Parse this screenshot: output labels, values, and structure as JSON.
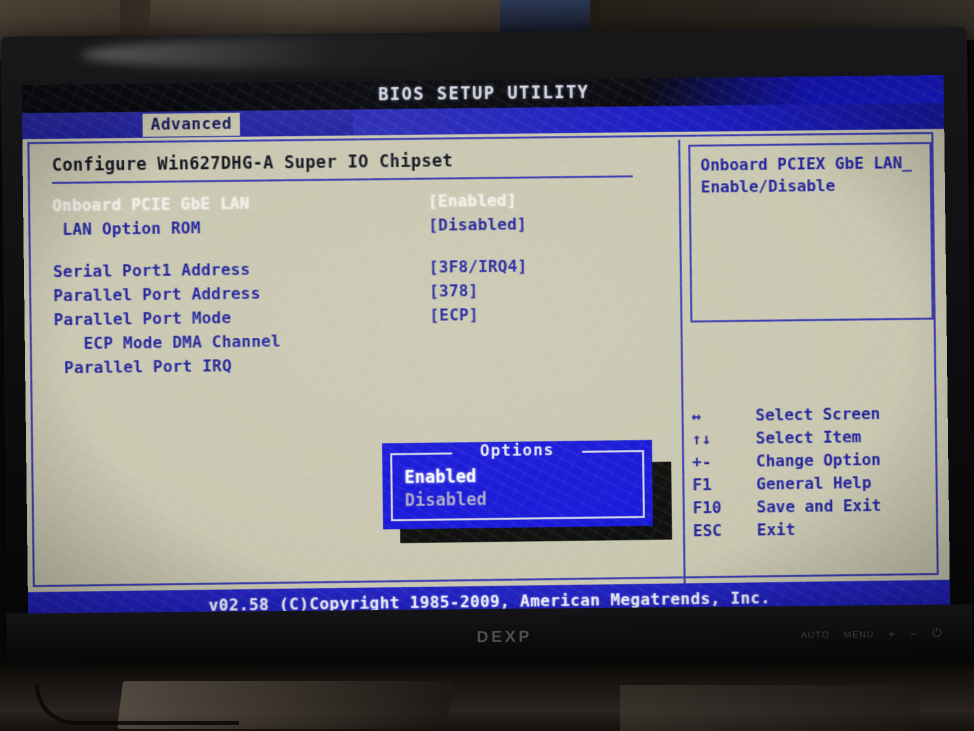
{
  "window": {
    "title": "BIOS SETUP UTILITY"
  },
  "menubar": {
    "active_tab": "Advanced"
  },
  "main": {
    "section_header": "Configure Win627DHG-A Super IO Chipset",
    "rows": [
      {
        "label": "Onboard PCIE GbE LAN",
        "value": "[Enabled]",
        "selected": true
      },
      {
        "label": " LAN Option ROM",
        "value": "[Disabled]",
        "selected": false
      },
      {
        "label": "",
        "value": "",
        "selected": false
      },
      {
        "label": "Serial Port1 Address",
        "value": "[3F8/IRQ4]",
        "selected": false
      },
      {
        "label": "Parallel Port Address",
        "value": "[378]",
        "selected": false
      },
      {
        "label": "Parallel Port Mode",
        "value": "[ECP]",
        "selected": false
      },
      {
        "label": "   ECP Mode DMA Channel",
        "value": "",
        "selected": false
      },
      {
        "label": " Parallel Port IRQ",
        "value": "",
        "selected": false
      }
    ]
  },
  "options_popup": {
    "title": "Options",
    "items": [
      {
        "label": "Enabled",
        "selected": true
      },
      {
        "label": "Disabled",
        "selected": false
      }
    ]
  },
  "help": {
    "text": "Onboard PCIEX GbE LAN_\nEnable/Disable"
  },
  "key_legend": [
    {
      "key": "↔",
      "desc": "Select Screen"
    },
    {
      "key": "↑↓",
      "desc": "Select Item"
    },
    {
      "key": "+-",
      "desc": "Change Option"
    },
    {
      "key": "F1",
      "desc": "General Help"
    },
    {
      "key": "F10",
      "desc": "Save and Exit"
    },
    {
      "key": "ESC",
      "desc": "Exit"
    }
  ],
  "footer": {
    "text": "v02.58 (C)Copyright 1985-2009, American Megatrends, Inc."
  },
  "monitor": {
    "brand": "DEXP",
    "osd_buttons": [
      "AUTO",
      "MENU",
      "+",
      "−",
      "⏻"
    ]
  },
  "colors": {
    "bios_background": "#c9c7b0",
    "bios_text_blue": "#22229c",
    "bios_border_blue": "#3b3bb0",
    "titlebar_blue": "#1b1bd6",
    "menubar_blue": "#2b2ba6",
    "tab_highlight": "#c9c6ac",
    "popup_blue": "#1717d8",
    "selected_text": "#ffffff",
    "footer_blue": "#2424c2"
  }
}
